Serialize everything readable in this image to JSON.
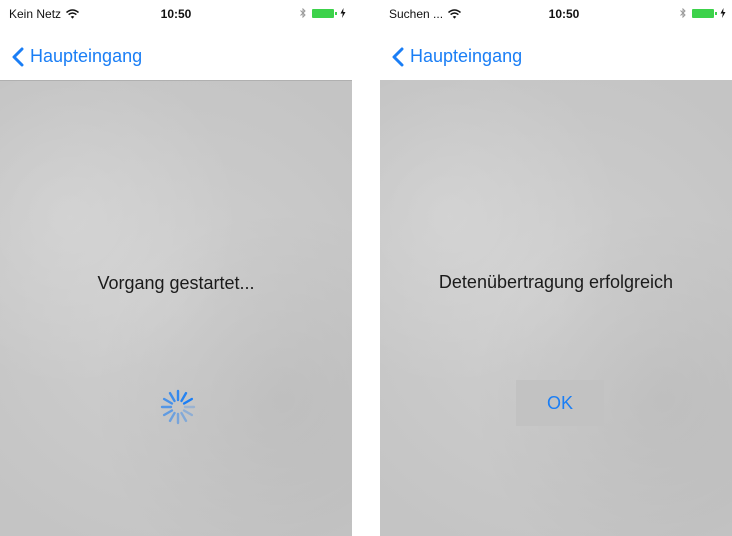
{
  "left_screen": {
    "status": {
      "carrier": "Kein Netz",
      "time": "10:50"
    },
    "nav": {
      "back_label": "Haupteingang"
    },
    "message": "Vorgang gestartet..."
  },
  "right_screen": {
    "status": {
      "carrier": "Suchen ...",
      "time": "10:50"
    },
    "nav": {
      "back_label": "Haupteingang"
    },
    "message": "Detenübertragung erfolgreich",
    "ok_label": "OK"
  },
  "colors": {
    "accent": "#1a7ef5",
    "battery": "#3cd24a",
    "content_bg": "#c9c9c9"
  },
  "icons": [
    "wifi-icon",
    "bluetooth-icon",
    "battery-icon",
    "charging-bolt-icon",
    "chevron-left-icon",
    "activity-spinner-icon"
  ]
}
